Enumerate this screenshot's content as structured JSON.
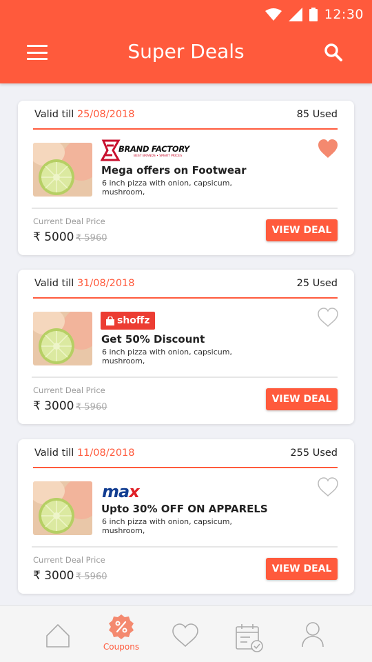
{
  "status": {
    "time": "12:30"
  },
  "header": {
    "title": "Super Deals"
  },
  "deals": [
    {
      "valid_prefix": "Valid till",
      "valid_date": "25/08/2018",
      "used": "85 Used",
      "logo": "BRAND FACTORY",
      "logo_tagline": "BEST BRANDS • SMART PRICES",
      "headline": "Mega offers on Footwear",
      "description": "6 inch pizza with onion, capsicum, mushroom,",
      "price_label": "Current Deal Price",
      "price": "₹ 5000",
      "old_price": "₹ 5960",
      "button": "VIEW DEAL",
      "favorited": true
    },
    {
      "valid_prefix": "Valid till",
      "valid_date": "31/08/2018",
      "used": "25 Used",
      "logo": "shoffz",
      "headline": "Get 50% Discount",
      "description": "6 inch pizza with onion, capsicum, mushroom,",
      "price_label": "Current Deal Price",
      "price": "₹ 3000",
      "old_price": "₹ 5960",
      "button": "VIEW DEAL",
      "favorited": false
    },
    {
      "valid_prefix": "Valid till",
      "valid_date": "11/08/2018",
      "used": "255 Used",
      "logo_left": "ma",
      "logo_right": "x",
      "headline": "Upto 30% OFF ON APPARELS",
      "description": "6 inch pizza with onion, capsicum, mushroom,",
      "price_label": "Current Deal Price",
      "price": "₹ 3000",
      "old_price": "₹ 5960",
      "button": "VIEW DEAL",
      "favorited": false
    }
  ],
  "bottom_nav": {
    "items": [
      {
        "icon": "home-icon"
      },
      {
        "icon": "coupon-icon",
        "label": "Coupons",
        "active": true
      },
      {
        "icon": "heart-icon"
      },
      {
        "icon": "calendar-check-icon"
      },
      {
        "icon": "user-icon"
      }
    ]
  },
  "colors": {
    "accent": "#ff5a3c",
    "background": "#f0f1f6",
    "favorite": "#f4896f"
  }
}
